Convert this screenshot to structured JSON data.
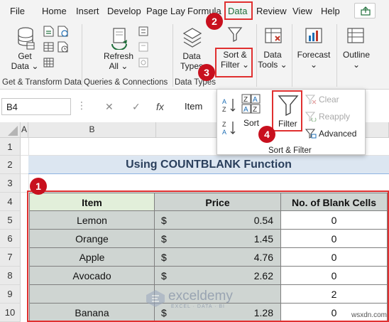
{
  "tabs": [
    "File",
    "Home",
    "Insert",
    "Develop",
    "Page Lay",
    "Formula",
    "Data",
    "Review",
    "View",
    "Help"
  ],
  "ribbon": {
    "get_data": "Get",
    "get_data_2": "Data",
    "group_get_transform": "Get & Transform Data",
    "refresh": "Refresh",
    "refresh_2": "All",
    "group_queries": "Queries & Connections",
    "data_types": "Data",
    "data_types_2": "Types",
    "group_data_types": "Data Types",
    "sort_filter": "Sort &",
    "sort_filter_2": "Filter",
    "data_tools": "Data",
    "data_tools_2": "Tools",
    "forecast": "Forecast",
    "outline": "Outline"
  },
  "formula_bar": {
    "name_box": "B4",
    "cancel": "✕",
    "confirm": "✓",
    "fx": "fx",
    "content": "Item"
  },
  "dropdown": {
    "sort": "Sort",
    "filter": "Filter",
    "clear": "Clear",
    "reapply": "Reapply",
    "advanced": "Advanced",
    "group_label": "Sort & Filter"
  },
  "columns": [
    "A",
    "B"
  ],
  "rows": [
    "1",
    "2",
    "3",
    "4",
    "5",
    "6",
    "7",
    "8",
    "9",
    "10"
  ],
  "sheet": {
    "title": "Using COUNTBLANK Function",
    "headers": [
      "Item",
      "Price",
      "No. of Blank Cells"
    ],
    "table": [
      {
        "item": "Lemon",
        "currency": "$",
        "price": "0.54",
        "blank": "0"
      },
      {
        "item": "Orange",
        "currency": "$",
        "price": "1.45",
        "blank": "0"
      },
      {
        "item": "Apple",
        "currency": "$",
        "price": "4.76",
        "blank": "0"
      },
      {
        "item": "Avocado",
        "currency": "$",
        "price": "2.62",
        "blank": "0"
      },
      {
        "item": "",
        "currency": "",
        "price": "",
        "blank": "2"
      },
      {
        "item": "Banana",
        "currency": "$",
        "price": "1.28",
        "blank": "0"
      }
    ]
  },
  "badges": [
    "1",
    "2",
    "3",
    "4"
  ],
  "watermark": {
    "name": "exceldemy",
    "tagline": "EXCEL · DATA · BI"
  },
  "corner_mark": "wsxdn.com",
  "colors": {
    "accent_red": "#e03030",
    "badge_red": "#c8101e",
    "excel_green": "#1e6e3a",
    "header_green": "#e2efda",
    "header_gray": "#cfd5d2",
    "title_blue": "#dce6f1"
  }
}
